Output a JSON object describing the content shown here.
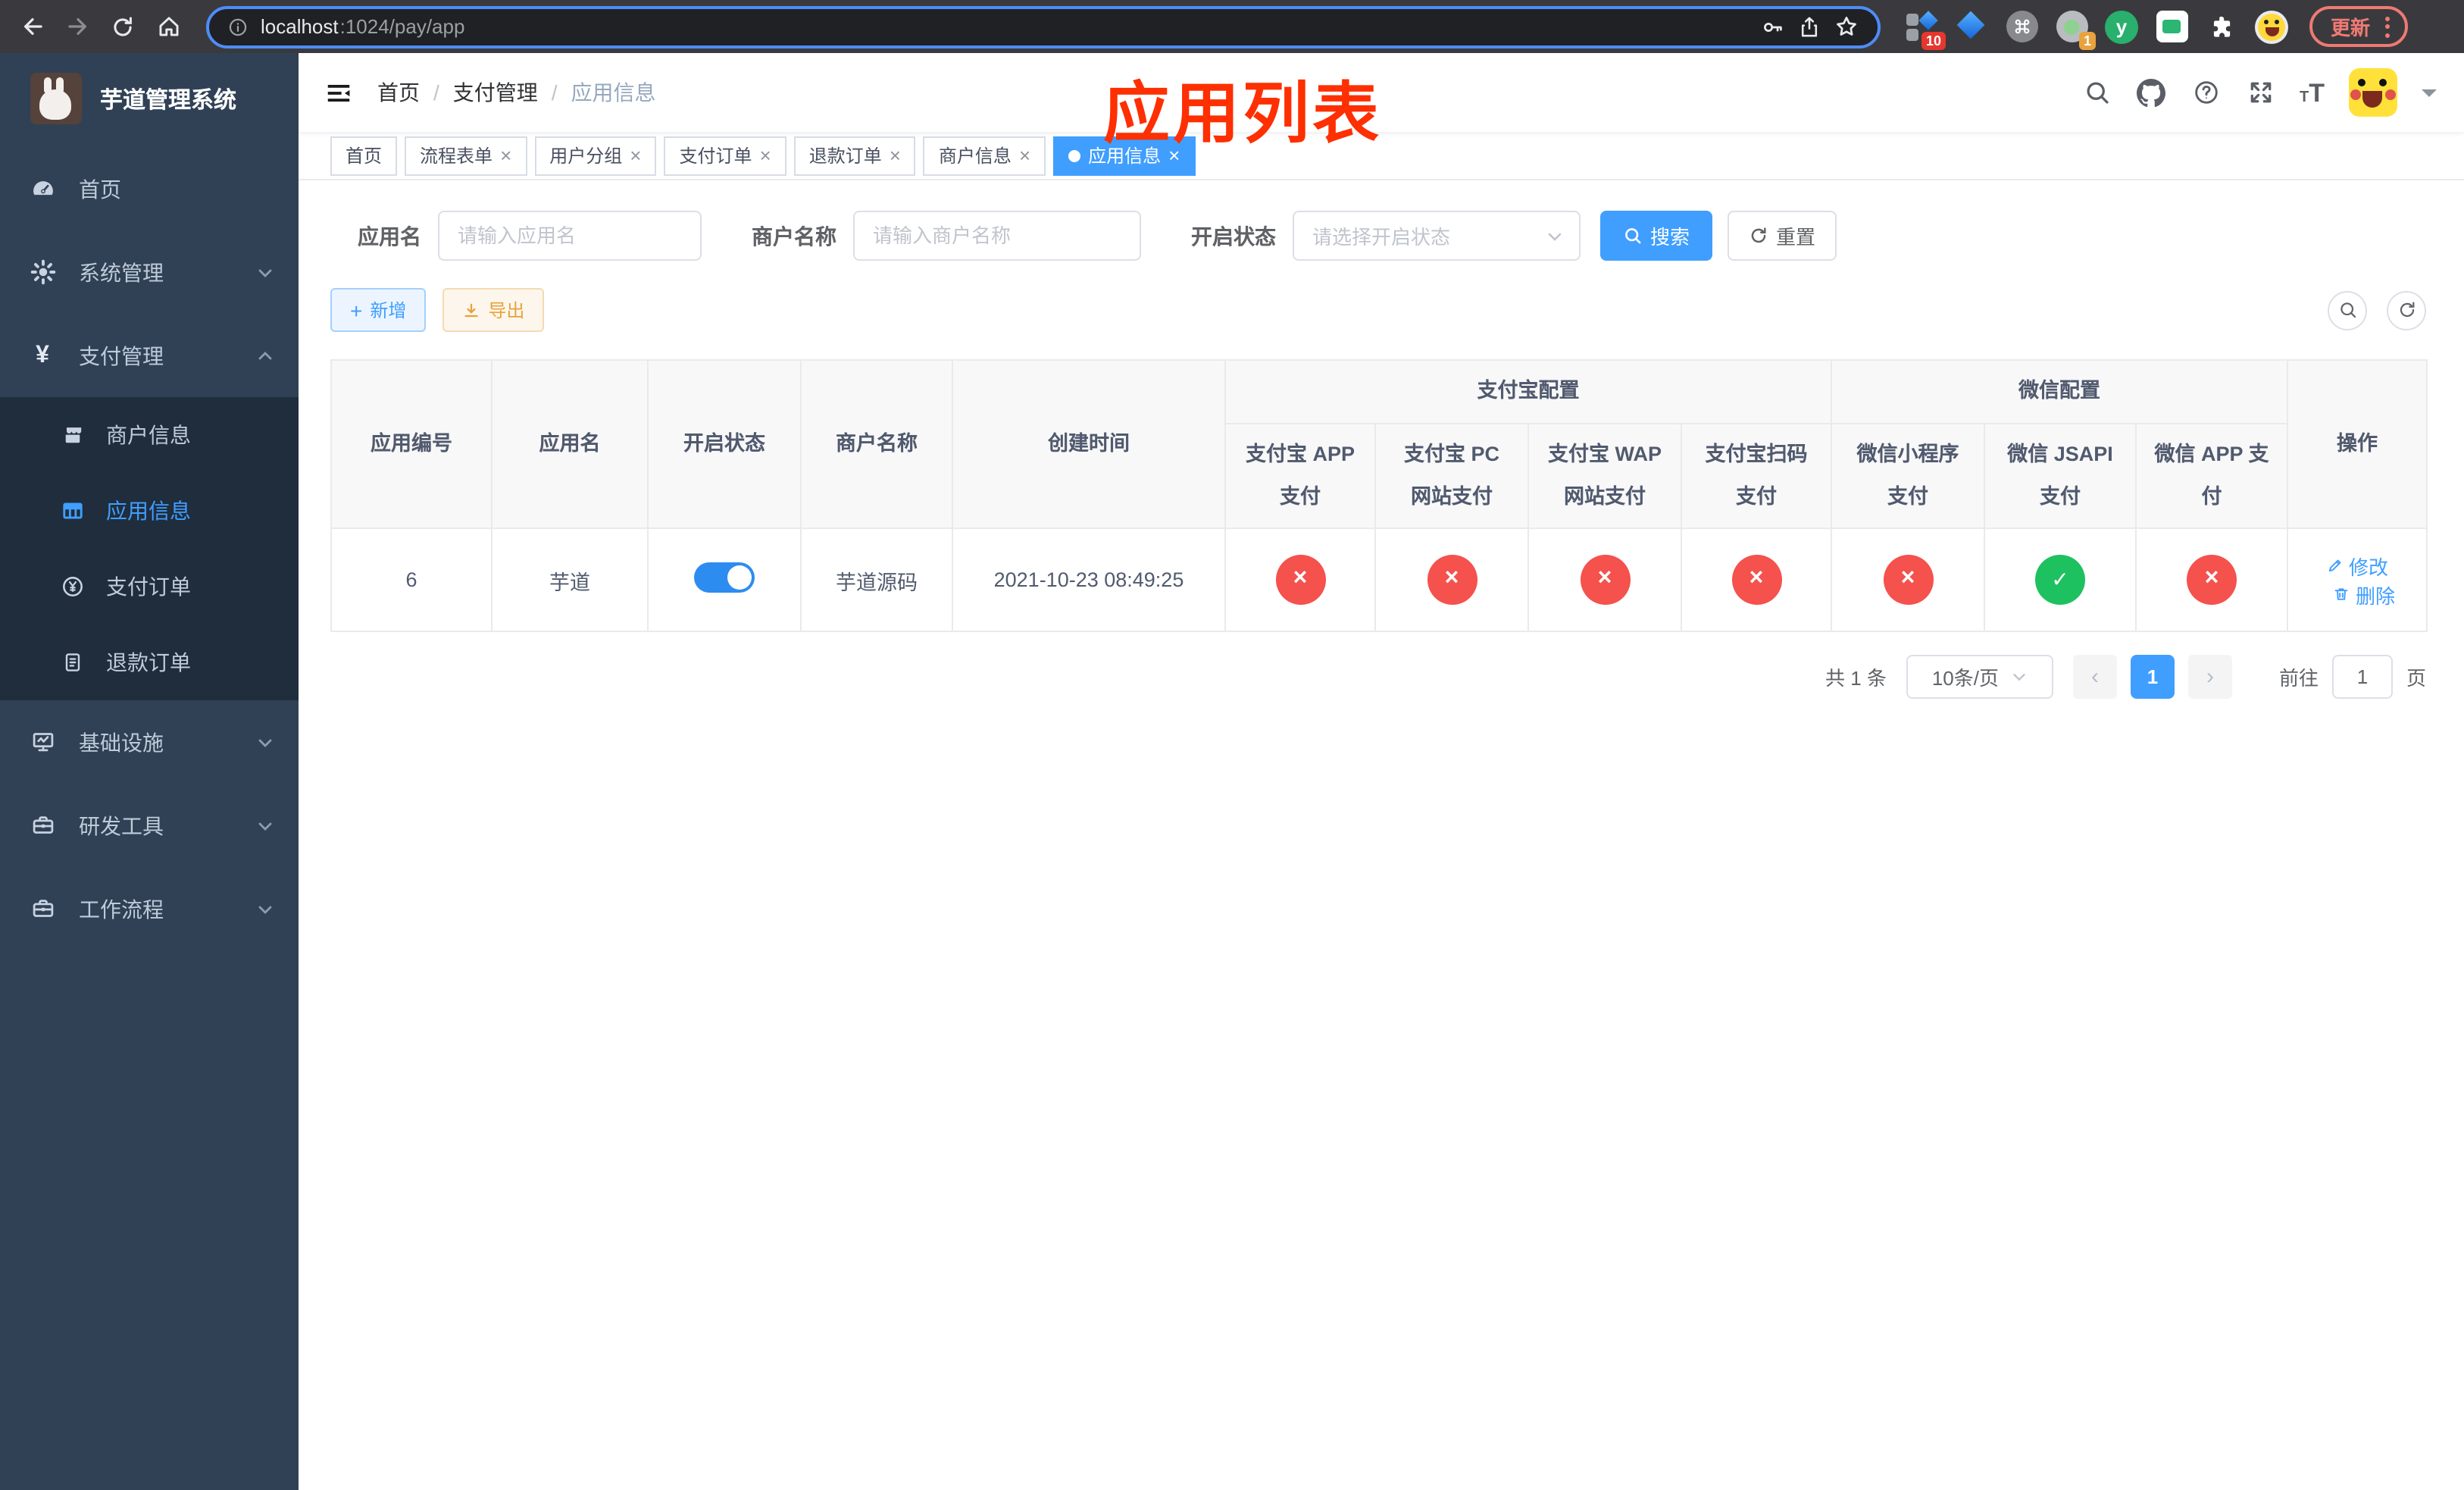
{
  "colors": {
    "primary": "#409eff",
    "success": "#1ec15f",
    "danger": "#f5514d",
    "warning": "#e6a23c",
    "annotation": "#fe2f00",
    "sidebar_bg": "#304156",
    "submenu_bg": "#1f2d3d"
  },
  "ui": {
    "close": "×",
    "sep": "/",
    "prev": "‹",
    "next": "›"
  },
  "browser": {
    "url_host": "localhost",
    "url_path": ":1024/pay/app",
    "update_label": "更新",
    "ext_badge_10": "10",
    "ext_badge_1": "1",
    "ext_y_letter": "y"
  },
  "sidebar": {
    "title": "芋道管理系统",
    "items": [
      {
        "label": "首页"
      },
      {
        "label": "系统管理"
      },
      {
        "label": "支付管理"
      },
      {
        "label": "商户信息"
      },
      {
        "label": "应用信息"
      },
      {
        "label": "支付订单"
      },
      {
        "label": "退款订单"
      },
      {
        "label": "基础设施"
      },
      {
        "label": "研发工具"
      },
      {
        "label": "工作流程"
      }
    ]
  },
  "header": {
    "breadcrumb": [
      "首页",
      "支付管理",
      "应用信息"
    ],
    "annotation": "应用列表"
  },
  "tabs": [
    {
      "label": "首页"
    },
    {
      "label": "流程表单"
    },
    {
      "label": "用户分组"
    },
    {
      "label": "支付订单"
    },
    {
      "label": "退款订单"
    },
    {
      "label": "商户信息"
    },
    {
      "label": "应用信息"
    }
  ],
  "filters": {
    "app_name": {
      "label": "应用名",
      "placeholder": "请输入应用名"
    },
    "merchant": {
      "label": "商户名称",
      "placeholder": "请输入商户名称"
    },
    "status": {
      "label": "开启状态",
      "placeholder": "请选择开启状态"
    },
    "search_label": "搜索",
    "reset_label": "重置"
  },
  "toolbar": {
    "add_label": "新增",
    "export_label": "导出"
  },
  "table": {
    "groups": {
      "alipay": "支付宝配置",
      "wechat": "微信配置"
    },
    "columns": {
      "id": "应用编号",
      "name": "应用名",
      "status": "开启状态",
      "merchant": "商户名称",
      "created": "创建时间",
      "ops": "操作",
      "sub": [
        "支付宝 APP 支付",
        "支付宝 PC 网站支付",
        "支付宝 WAP 网站支付",
        "支付宝扫码支付",
        "微信小程序支付",
        "微信 JSAPI 支付",
        "微信 APP 支付"
      ]
    },
    "row": {
      "id": "6",
      "name": "芋道",
      "status": "on",
      "merchant": "芋道源码",
      "created": "2021-10-23 08:49:25",
      "configs": [
        "disabled",
        "disabled",
        "disabled",
        "disabled",
        "disabled",
        "enabled",
        "disabled"
      ],
      "edit_label": "修改",
      "delete_label": "删除"
    }
  },
  "pagination": {
    "total": "共 1 条",
    "page_size": "10条/页",
    "page": "1",
    "goto_label": "前往",
    "goto_value": "1",
    "unit_label": "页"
  }
}
